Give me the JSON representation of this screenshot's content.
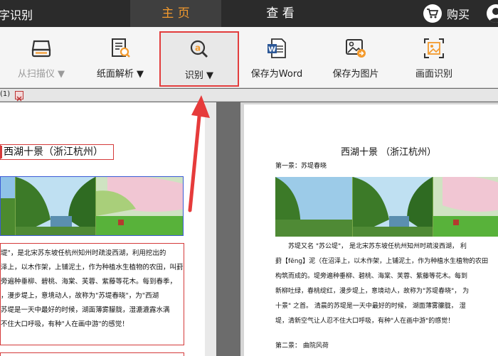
{
  "app": {
    "title": "文字识别"
  },
  "tabs": {
    "home": "主 页",
    "view": "查 看"
  },
  "header": {
    "buy_label": "购买"
  },
  "toolbar": {
    "scanner": "从扫描仪 ▼",
    "layout": "纸面解析 ▼",
    "ocr": "识别 ▼",
    "save_word": "保存为Word",
    "save_image": "保存为图片",
    "screen_ocr": "画面识别"
  },
  "doc_tab": {
    "label": "(1)"
  },
  "colors": {
    "accent": "#f39a2d",
    "highlight_border": "#e23c3c",
    "arrow": "#e63b3b"
  },
  "left_page": {
    "title": "西湖十景（浙江杭州）",
    "lines": [
      "堤\"，是北宋苏东坡任杭州知州时疏浚西湖，利用挖出的",
      "泽上，以木作架，上铺泥土，作为种植水生植物的农田，叫葑",
      "旁遍种垂柳、碧桃、海棠、芙蓉、紫藤等花木。每到春季，",
      "，漫步堤上，意境动人，故称为\"苏堤春晓\"，为\"西湖",
      "苏堤是一天中最好的时候，湖面薄雾朦胧，湿漉漉露水满",
      "不住大口呼吸，有种\"人在画中游\"的感觉！"
    ]
  },
  "right_page": {
    "title": "西湖十景 （浙江杭州）",
    "section1": "第一景：苏堤春晓",
    "lines": [
      "苏堤又名 \"苏公堤\"， 是北宋苏东坡任杭州知州时疏浚西湖， 利",
      "葑【fēng】泥（在沼泽上，以木作架，上铺泥土，作为种植水生植物的农田",
      "构筑而成的。堤旁遍种垂柳、碧桃、海棠、芙蓉、紫藤等花木。每到",
      "新柳吐绿，春桃绽红，漫步堤上，意境动人，故称为\"苏堤春晓\"， 为",
      "十景\" 之首。 清晨的苏堤是一天中最好的时候， 湖面薄雾朦胧， 湿",
      "堤，清新空气让人忍不住大口呼吸，有种\"人在画中游\"的感觉！"
    ],
    "section2": "第二景： 曲院风荷"
  }
}
